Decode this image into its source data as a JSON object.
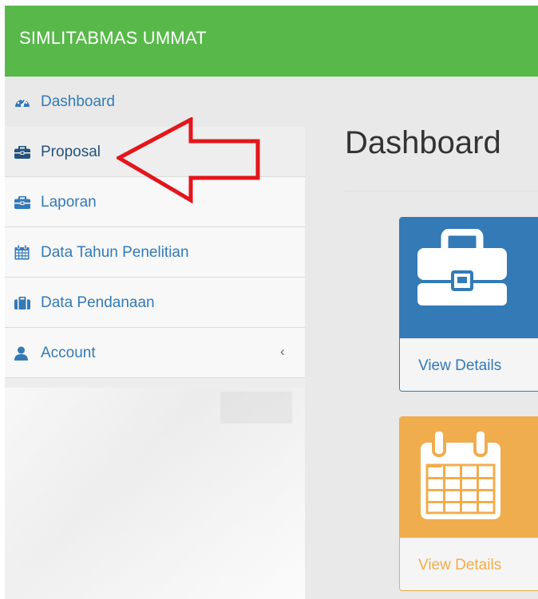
{
  "navbar": {
    "brand": "SIMLITABMAS UMMAT"
  },
  "sidebar": {
    "items": [
      {
        "label": "Dashboard",
        "icon": "dashboard-icon"
      },
      {
        "label": "Proposal",
        "icon": "briefcase-icon"
      },
      {
        "label": "Laporan",
        "icon": "briefcase-icon"
      },
      {
        "label": "Data Tahun Penelitian",
        "icon": "calendar-icon"
      },
      {
        "label": "Data Pendanaan",
        "icon": "suitcase-icon"
      },
      {
        "label": "Account",
        "icon": "user-icon",
        "chevron": "‹"
      }
    ]
  },
  "main": {
    "title": "Dashboard",
    "panels": [
      {
        "link": "View Details",
        "icon": "briefcase-icon",
        "color": "#337ab7"
      },
      {
        "link": "View Details",
        "icon": "calendar-icon",
        "color": "#f0ad4e"
      }
    ]
  },
  "annotation": {
    "arrow_color": "#e3161b"
  },
  "colors": {
    "navbar": "#58b94a",
    "link": "#337ab7"
  }
}
